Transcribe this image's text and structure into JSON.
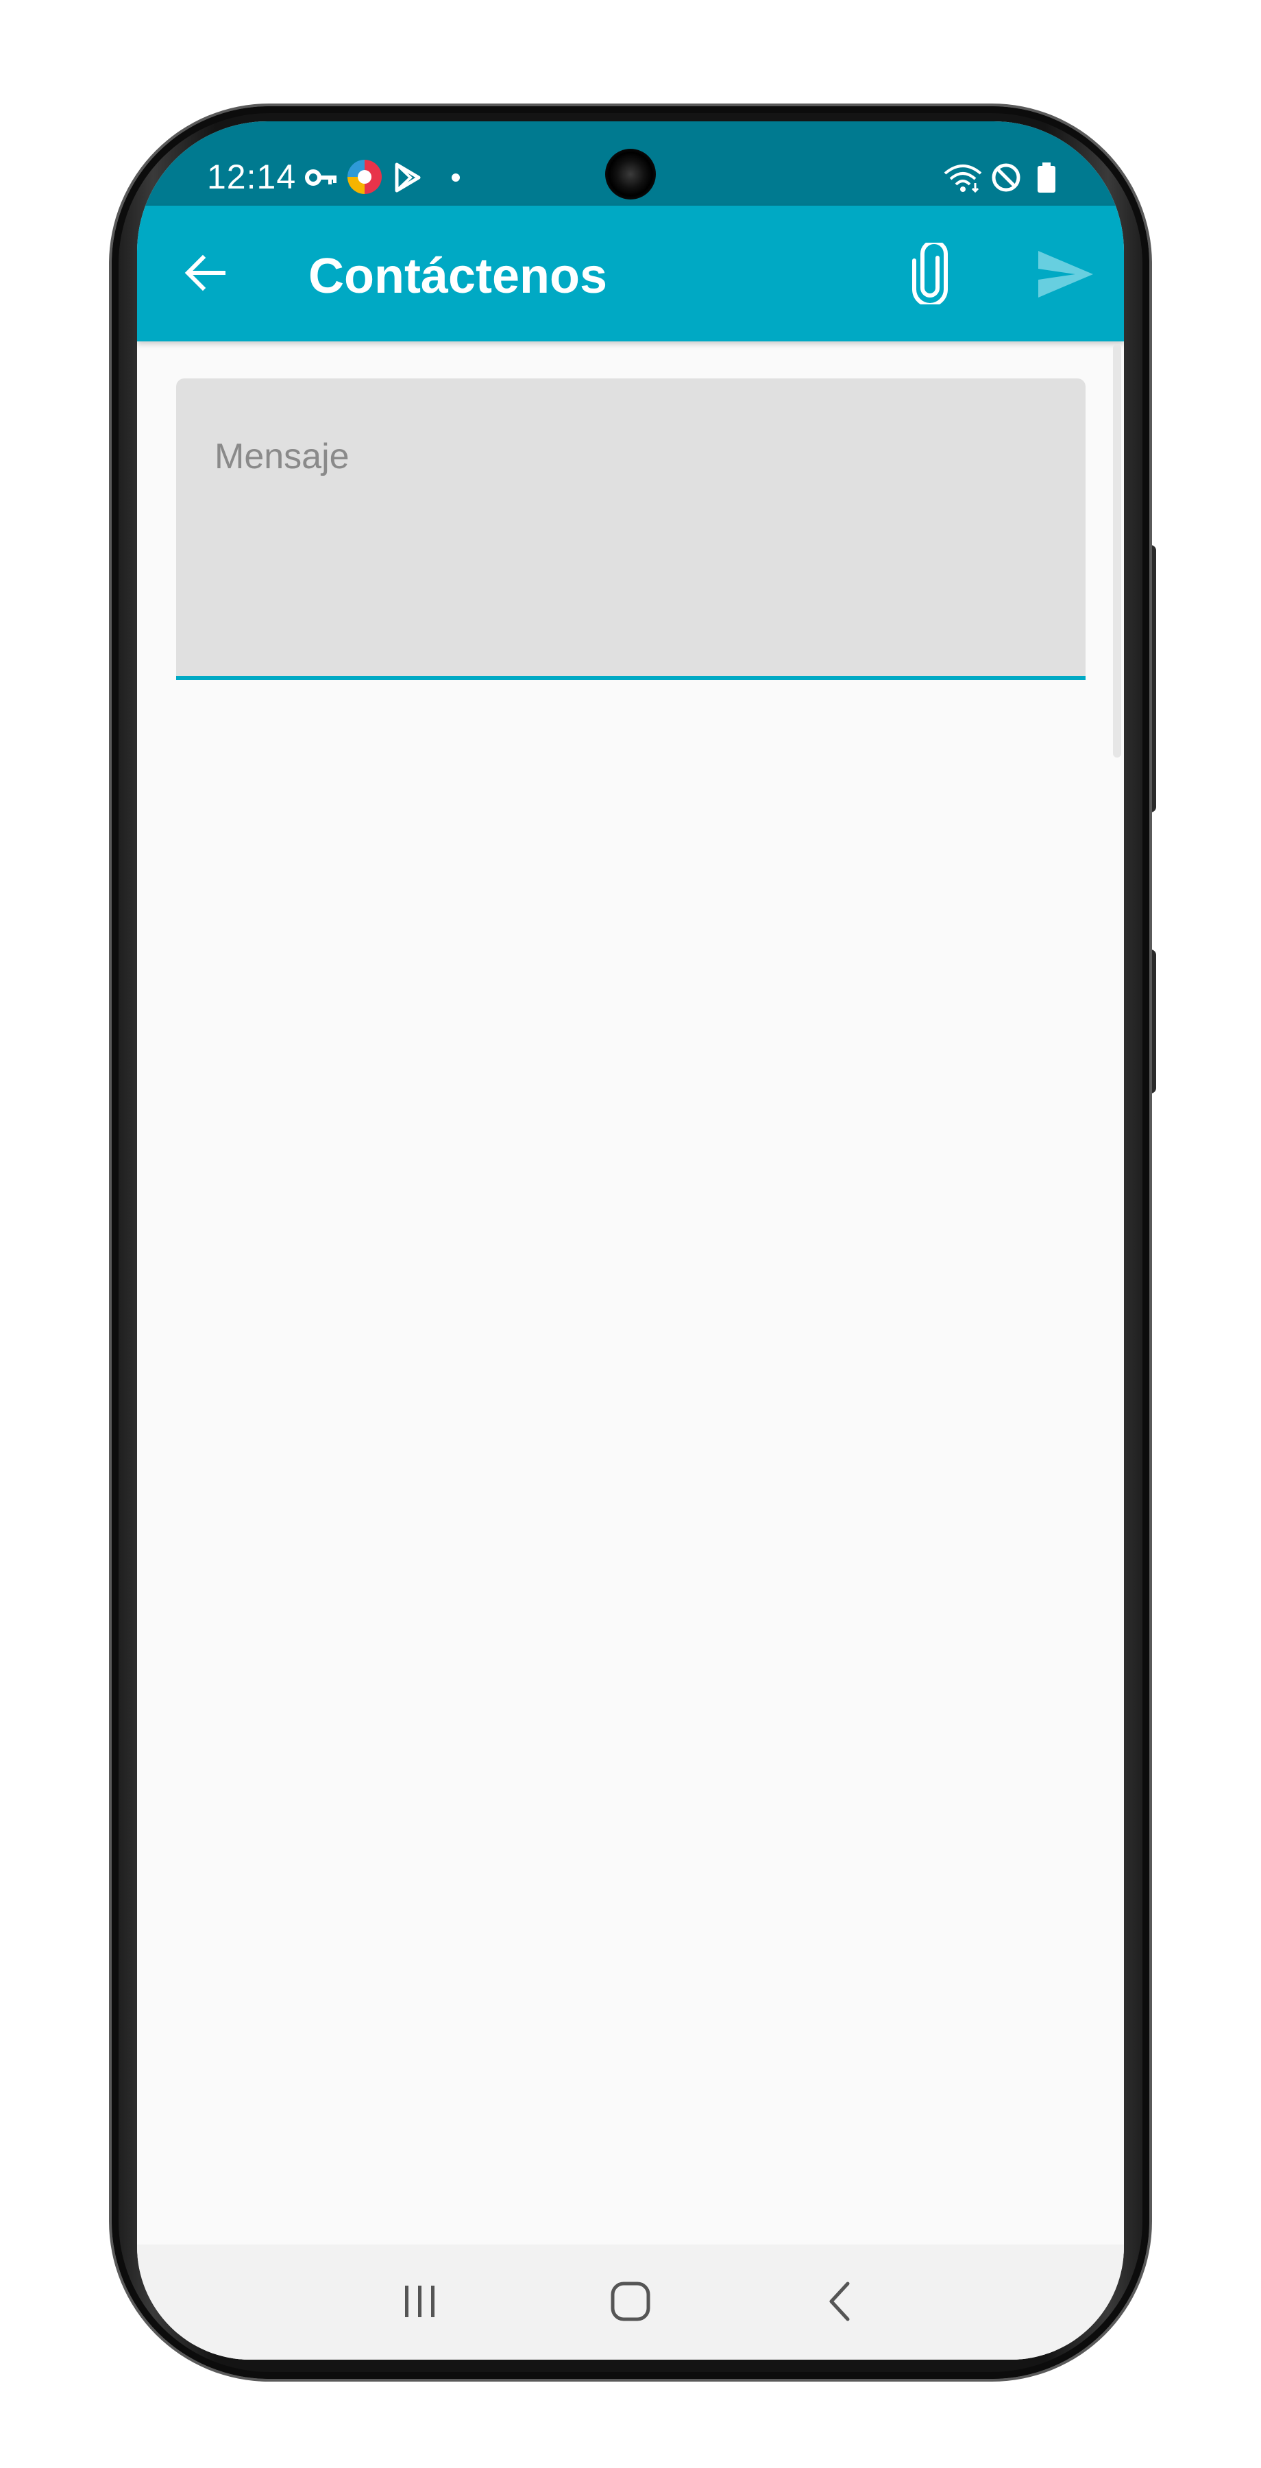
{
  "status_bar": {
    "time": "12:14",
    "left_icons": [
      "vpn-key-icon",
      "app-logo-icon",
      "play-store-icon",
      "notification-dot-icon"
    ],
    "right_icons": [
      "wifi-icon",
      "do-not-disturb-icon",
      "battery-icon"
    ]
  },
  "app_bar": {
    "title": "Contáctenos",
    "background_color": "#00a9c4",
    "back_icon": "arrow-back-icon",
    "attach_icon": "paperclip-icon",
    "send_icon": "send-icon"
  },
  "form": {
    "message_placeholder": "Mensaje",
    "message_value": ""
  },
  "nav_bar": {
    "items": [
      "recent-apps-icon",
      "home-icon",
      "back-icon"
    ]
  }
}
